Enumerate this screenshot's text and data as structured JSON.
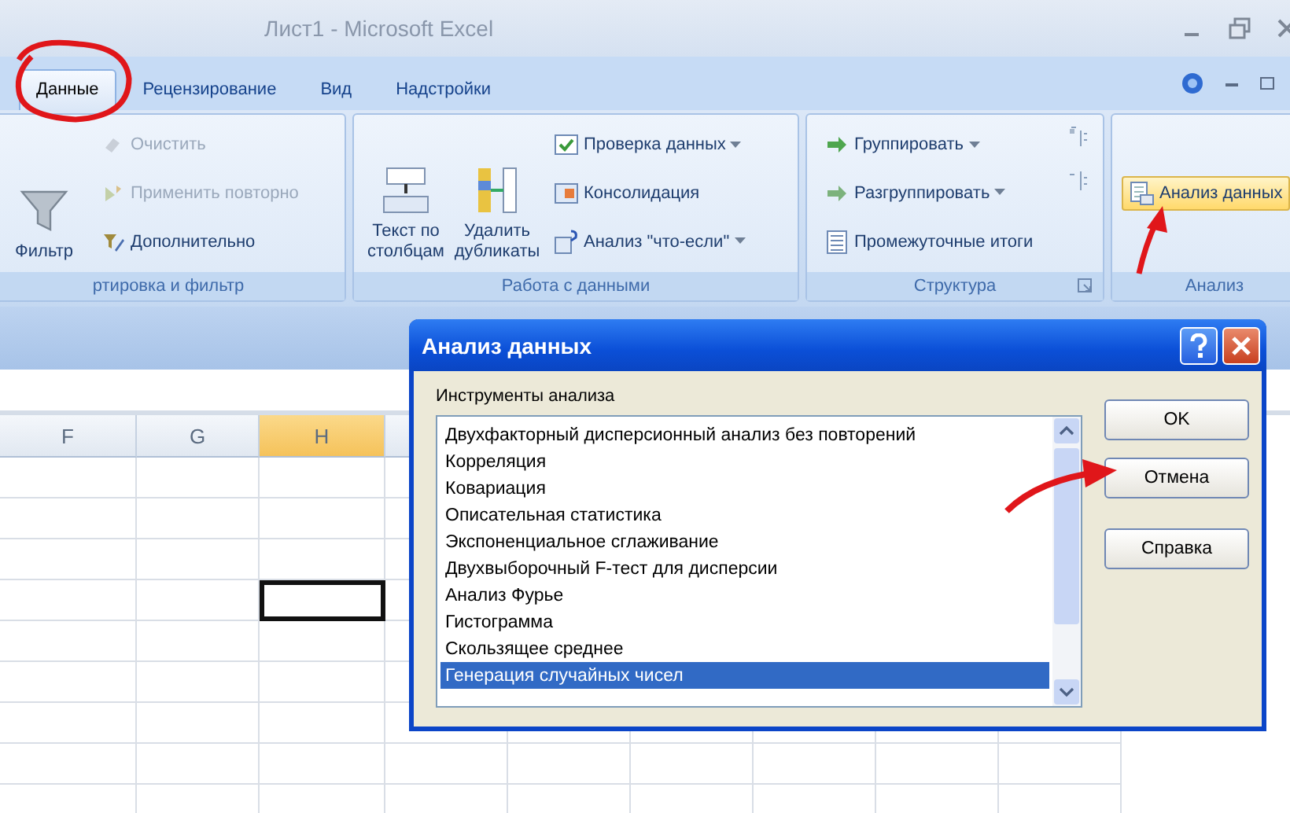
{
  "window": {
    "title": "Лист1 - Microsoft Excel"
  },
  "ribbon_tabs": [
    {
      "label": "Данные",
      "selected": true
    },
    {
      "label": "Рецензирование",
      "selected": false
    },
    {
      "label": "Вид",
      "selected": false
    },
    {
      "label": "Надстройки",
      "selected": false
    }
  ],
  "ribbon_groups": [
    {
      "label": "ртировка и фильтр",
      "commands": [
        {
          "label": "Фильтр",
          "kind": "large",
          "disabled": false
        },
        {
          "label": "Очистить",
          "kind": "small",
          "disabled": true
        },
        {
          "label": "Применить повторно",
          "kind": "small",
          "disabled": true
        },
        {
          "label": "Дополнительно",
          "kind": "small",
          "disabled": false
        }
      ]
    },
    {
      "label": "Работа с данными",
      "commands": [
        {
          "label": "Текст по столбцам",
          "kind": "large",
          "disabled": false
        },
        {
          "label": "Удалить дубликаты",
          "kind": "large",
          "disabled": false
        },
        {
          "label": "Проверка данных",
          "kind": "small",
          "disabled": false,
          "dropdown": true
        },
        {
          "label": "Консолидация",
          "kind": "small",
          "disabled": false
        },
        {
          "label": "Анализ \"что-если\"",
          "kind": "small",
          "disabled": false,
          "dropdown": true
        }
      ]
    },
    {
      "label": "Структура",
      "launcher": true,
      "commands": [
        {
          "label": "Группировать",
          "kind": "small",
          "disabled": false,
          "dropdown": true
        },
        {
          "label": "Разгруппировать",
          "kind": "small",
          "disabled": false,
          "dropdown": true
        },
        {
          "label": "Промежуточные итоги",
          "kind": "small",
          "disabled": false
        },
        {
          "kind": "icon",
          "disabled": false
        },
        {
          "kind": "icon",
          "disabled": false
        }
      ]
    },
    {
      "label": "Анализ",
      "commands": [
        {
          "label": "Анализ данных",
          "kind": "small",
          "disabled": false,
          "highlighted": true
        }
      ]
    }
  ],
  "sheet": {
    "columns": [
      {
        "label": "F",
        "selected": false
      },
      {
        "label": "G",
        "selected": false
      },
      {
        "label": "H",
        "selected": true
      }
    ],
    "rows": [
      {
        "cells": [
          {
            "selected": false
          },
          {
            "selected": false
          },
          {
            "selected": false
          }
        ]
      },
      {
        "cells": [
          {
            "selected": false
          },
          {
            "selected": false
          },
          {
            "selected": false
          }
        ]
      },
      {
        "cells": [
          {
            "selected": false
          },
          {
            "selected": false
          },
          {
            "selected": false
          }
        ]
      },
      {
        "cells": [
          {
            "selected": false
          },
          {
            "selected": false
          },
          {
            "selected": true
          }
        ]
      },
      {
        "cells": [
          {
            "selected": false
          },
          {
            "selected": false
          },
          {
            "selected": false
          }
        ]
      },
      {
        "cells": [
          {
            "selected": false
          },
          {
            "selected": false
          },
          {
            "selected": false
          }
        ]
      },
      {
        "cells": [
          {
            "selected": false
          },
          {
            "selected": false
          },
          {
            "selected": false
          }
        ]
      },
      {
        "cells": [
          {
            "selected": false
          },
          {
            "selected": false
          },
          {
            "selected": false
          }
        ]
      },
      {
        "cells": [
          {
            "selected": false
          },
          {
            "selected": false
          },
          {
            "selected": false
          }
        ]
      }
    ]
  },
  "dialog": {
    "title": "Анализ данных",
    "list_label": "Инструменты анализа",
    "items": [
      {
        "label": "Двухфакторный дисперсионный анализ без повторений",
        "selected": false
      },
      {
        "label": "Корреляция",
        "selected": false
      },
      {
        "label": "Ковариация",
        "selected": false
      },
      {
        "label": "Описательная статистика",
        "selected": false
      },
      {
        "label": "Экспоненциальное сглаживание",
        "selected": false
      },
      {
        "label": "Двухвыборочный F-тест для дисперсии",
        "selected": false
      },
      {
        "label": "Анализ Фурье",
        "selected": false
      },
      {
        "label": "Гистограмма",
        "selected": false
      },
      {
        "label": "Скользящее среднее",
        "selected": false
      },
      {
        "label": "Генерация случайных чисел",
        "selected": true
      }
    ],
    "buttons": [
      "OK",
      "Отмена",
      "Справка"
    ]
  }
}
